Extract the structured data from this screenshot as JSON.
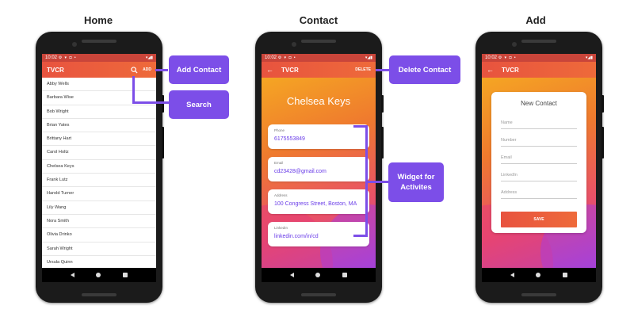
{
  "headings": {
    "home": "Home",
    "contact": "Contact",
    "add": "Add"
  },
  "status_time": "10:02",
  "app_title": "TVCR",
  "home": {
    "add_label": "ADD",
    "contacts": [
      "Abby Wells",
      "Barbara Wise",
      "Bob Wright",
      "Brian Yates",
      "Brittany Hart",
      "Carol Holtz",
      "Chelsea Keys",
      "Frank Lutz",
      "Harold Turner",
      "Lily Wang",
      "Nora Smith",
      "Olivia Drinko",
      "Sarah Wright",
      "Ursula Quinn"
    ]
  },
  "contact": {
    "delete_label": "DELETE",
    "name": "Chelsea Keys",
    "fields": [
      {
        "label": "Phone",
        "value": "6175553849"
      },
      {
        "label": "Email",
        "value": "cd23428@gmail.com"
      },
      {
        "label": "Address",
        "value": "100 Congress Street, Boston, MA"
      },
      {
        "label": "LinkedIn",
        "value": "linkedin.com/in/cd"
      }
    ]
  },
  "add": {
    "card_title": "New Contact",
    "placeholders": [
      "Name",
      "Number",
      "Email",
      "LinkedIn",
      "Address"
    ],
    "save_label": "SAVE"
  },
  "callouts": {
    "add_contact": "Add Contact",
    "search": "Search",
    "delete_contact": "Delete Contact",
    "widget_line1": "Widget for",
    "widget_line2": "Activites"
  },
  "colors": {
    "accent": "#7c4ee8",
    "appbar": "#e8533f",
    "link": "#6a3de8"
  }
}
